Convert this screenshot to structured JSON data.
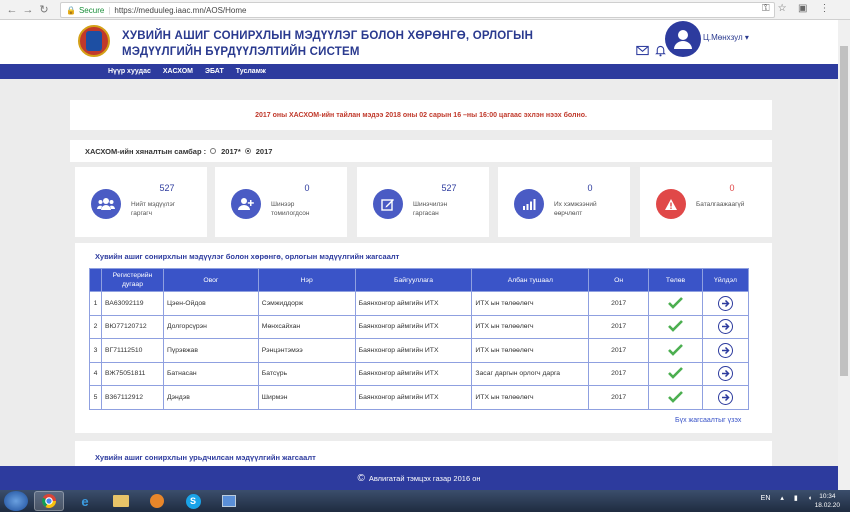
{
  "browser": {
    "secure_label": "Secure",
    "url": "https://meduuleg.iaac.mn/AOS/Home"
  },
  "header": {
    "title_line1": "ХУВИЙН АШИГ СОНИРХЛЫН МЭДҮҮЛЭГ БОЛОН ХӨРӨНГӨ, ОРЛОГЫН",
    "title_line2": "МЭДҮҮЛГИЙН БҮРДҮҮЛЭЛТИЙН СИСТЕМ",
    "username": "Ц.Мөнхзул"
  },
  "nav": [
    "Нүүр хуудас",
    "ХАСХОМ",
    "ЭБАТ",
    "Тусламж"
  ],
  "notice": "2017 оны ХАСХОМ-ийн тайлан мэдээ 2018 оны 02 сарын 16 –ны 16:00 цагаас эхлэн нээх болно.",
  "dashboard": {
    "label": "ХАСХОМ-ийн хяналтын самбар :",
    "option1": "2017*",
    "option2": "2017"
  },
  "stats": [
    {
      "value": "527",
      "label1": "Нийт мэдүүлэг",
      "label2": "гаргагч",
      "color": "#4a5bc4",
      "icon": "users-icon"
    },
    {
      "value": "0",
      "label1": "Шинээр",
      "label2": "томилогдсон",
      "color": "#4a5bc4",
      "icon": "add-user-icon"
    },
    {
      "value": "527",
      "label1": "Шинэчилэн",
      "label2": "гаргасан",
      "color": "#4a5bc4",
      "icon": "edit-icon"
    },
    {
      "value": "0",
      "label1": "Их хэмжээний",
      "label2": "өөрчлөлт",
      "color": "#4a5bc4",
      "icon": "bar-chart-icon"
    },
    {
      "value": "0",
      "label1": "Баталгаажаагүй",
      "label2": "",
      "color": "#e04848",
      "icon": "warning-icon"
    }
  ],
  "table": {
    "title": "Хувийн ашиг сонирхлын мэдүүлэг болон хөрөнгө, орлогын мэдүүлгийн жагсаалт",
    "headers": [
      "Регистерийн дугаар",
      "Овог",
      "Нэр",
      "Байгууллага",
      "Албан тушаал",
      "Он",
      "Төлөв",
      "Үйлдэл"
    ],
    "rows": [
      {
        "n": "1",
        "reg": "ВА63092119",
        "last": "Цэен-Ойдов",
        "first": "Сэмжиддорж",
        "org": "Баянхонгор аймгийн ИТХ",
        "pos": "ИТХ ын төлөөлөгч",
        "year": "2017"
      },
      {
        "n": "2",
        "reg": "ВЮ77120712",
        "last": "Долгорсүрэн",
        "first": "Мөнхсайхан",
        "org": "Баянхонгор аймгийн ИТХ",
        "pos": "ИТХ ын төлөөлөгч",
        "year": "2017"
      },
      {
        "n": "3",
        "reg": "ВГ71112510",
        "last": "Пүрэвжав",
        "first": "Рэнцэнтэмээ",
        "org": "Баянхонгор аймгийн ИТХ",
        "pos": "ИТХ ын төлөөлөгч",
        "year": "2017"
      },
      {
        "n": "4",
        "reg": "ВЖ75051811",
        "last": "Батнасан",
        "first": "Батсүрь",
        "org": "Баянхонгор аймгийн ИТХ",
        "pos": "Засаг даргын орлогч дарга",
        "year": "2017"
      },
      {
        "n": "5",
        "reg": "В367112912",
        "last": "Дэндэв",
        "first": "Ширмэн",
        "org": "Баянхонгор аймгийн ИТХ",
        "pos": "ИТХ ын төлөөлөгч",
        "year": "2017"
      }
    ],
    "see_all": "Бүх жагсаалтыг үзэх"
  },
  "section2_title": "Хувийн ашиг сонирхлын урьдчилсан мэдүүлгийн жагсаалт",
  "footer": "Авлигатай тэмцэх газар 2016 он",
  "taskbar": {
    "lang": "EN",
    "time": "10:34",
    "date": "18.02.20"
  }
}
